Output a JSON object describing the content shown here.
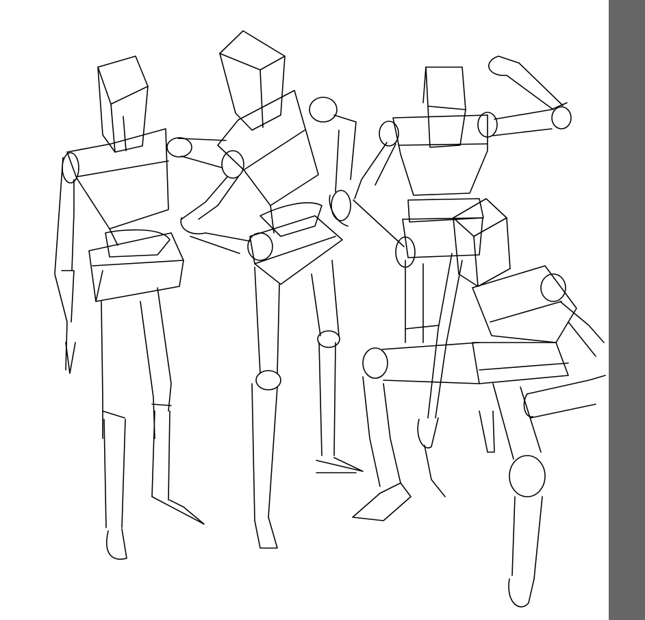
{
  "colors": {
    "canvas": "#ffffff",
    "ink": "#000000",
    "side_panel": "#666666"
  },
  "figures": [
    {
      "name": "mannequin-standing-front"
    },
    {
      "name": "mannequin-hands-on-hips"
    },
    {
      "name": "mannequin-flexing-arm"
    },
    {
      "name": "mannequin-crouching"
    }
  ]
}
